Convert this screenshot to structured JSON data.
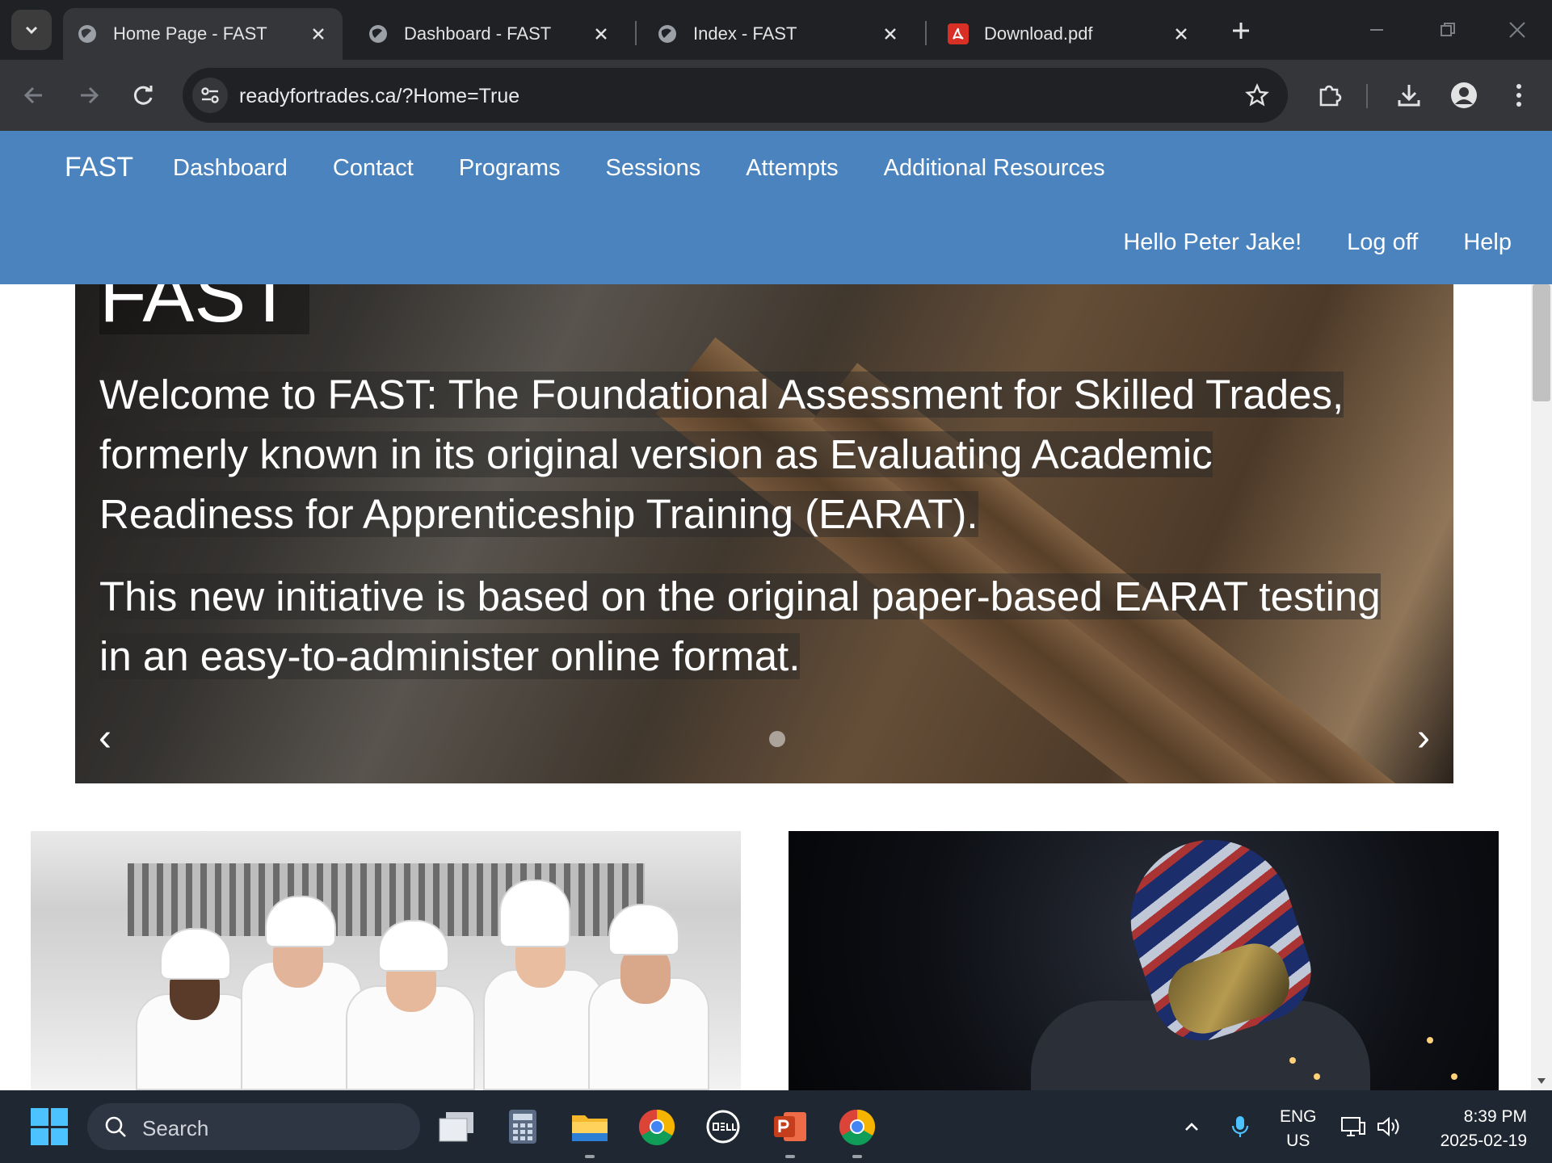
{
  "browser": {
    "tabs": [
      {
        "title": "Home Page - FAST",
        "active": true
      },
      {
        "title": "Dashboard - FAST",
        "active": false
      },
      {
        "title": "Index - FAST",
        "active": false
      },
      {
        "title": "Download.pdf",
        "active": false
      }
    ],
    "url": "readyfortrades.ca/?Home=True"
  },
  "site": {
    "brand": "FAST",
    "nav": [
      "Dashboard",
      "Contact",
      "Programs",
      "Sessions",
      "Attempts",
      "Additional Resources"
    ],
    "user": {
      "greeting": "Hello Peter Jake!",
      "logoff": "Log off",
      "help": "Help"
    },
    "accent_color": "#4a83be"
  },
  "carousel": {
    "heading": "FAST",
    "paragraph1": "Welcome to FAST: The Foundational Assessment for Skilled Trades, formerly known in its original version as Evaluating Academic Readiness for Apprenticeship Training (EARAT).",
    "paragraph2": "This new initiative is based on the original paper-based EARAT testing in an easy-to-administer online format.",
    "prev": "‹",
    "next": "›"
  },
  "taskbar": {
    "search_label": "Search",
    "language": {
      "line1": "ENG",
      "line2": "US"
    },
    "time": "8:39 PM",
    "date": "2025-02-19"
  }
}
